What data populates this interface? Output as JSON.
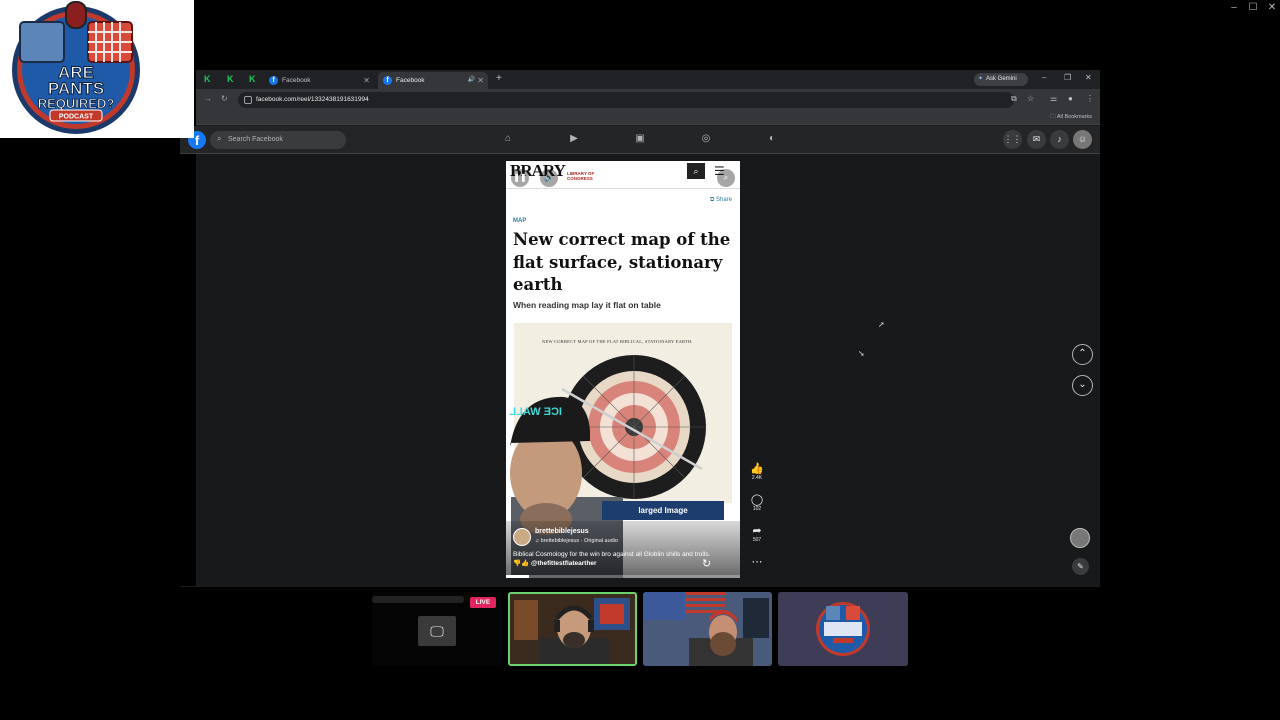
{
  "podcast": {
    "logo_lines": [
      "ARE",
      "PANTS",
      "REQUIRED?"
    ],
    "logo_banner": "PODCAST"
  },
  "browser": {
    "tabs": [
      {
        "label": "Facebook",
        "active": false
      },
      {
        "label": "Facebook",
        "active": true
      }
    ],
    "gemini_label": "Ask Gemini",
    "url": "facebook.com/reel/1332438191631994",
    "bookmarks_label": "All Bookmarks"
  },
  "facebook": {
    "logo_letter": "f",
    "search_placeholder": "Search Facebook"
  },
  "reel": {
    "masthead_word": "BRARY",
    "masthead_sub": "LIBRARY OF CONGRESS",
    "share_label": "Share",
    "category": "MAP",
    "headline": "New correct map of the flat surface, stationary earth",
    "subhead": "When reading map lay it flat on table",
    "map_title": "NEW CORRECT MAP OF THE FLAT BIBLICAL, STATIONARY EARTH.",
    "hat_text": "ICE WALL",
    "enlarge_label": "larged Image",
    "author": "brettebiblejesus",
    "audio": "brettebiblejesus · Original audio",
    "caption": "Biblical Cosmology for the win bro against all Globlin shills and trolls.",
    "mention": "@thefittestflatearther",
    "progress": 0.1
  },
  "actions": {
    "like_count": "2.4K",
    "comment_count": "102",
    "share_count": "507"
  },
  "stream": {
    "live_label": "LIVE"
  },
  "colors": {
    "fb_blue": "#1877f2",
    "live_red": "#e0245e",
    "active_speaker": "#6bd36b",
    "map_red": "#d9847a"
  }
}
